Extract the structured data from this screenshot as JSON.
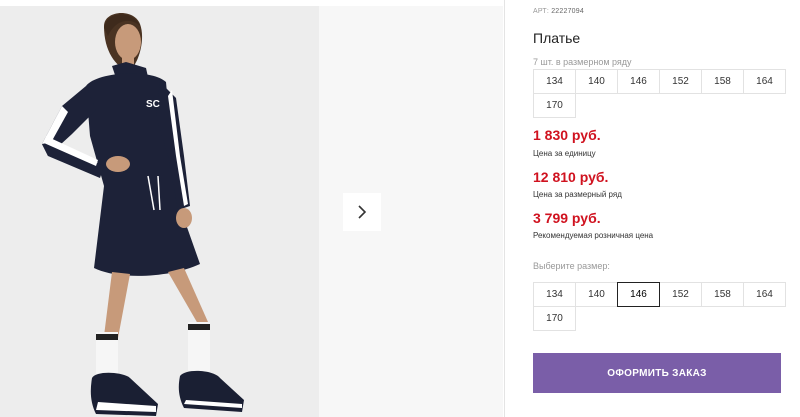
{
  "product": {
    "article_label": "АРТ:",
    "article_number": "22227094",
    "title": "Платье",
    "row_note": "7 шт. в размерном ряду",
    "row_sizes": [
      "134",
      "140",
      "146",
      "152",
      "158",
      "164",
      "170"
    ]
  },
  "prices": {
    "unit_price": "1 830 руб.",
    "unit_label": "Цена за единицу",
    "row_price": "12 810 руб.",
    "row_label": "Цена за размерный ряд",
    "retail_price": "3 799 руб.",
    "retail_label": "Рекомендуемая розничная цена",
    "accent_color": "#d0121f"
  },
  "size_picker": {
    "label": "Выберите размер:",
    "options": [
      "134",
      "140",
      "146",
      "152",
      "158",
      "164",
      "170"
    ],
    "selected": "146"
  },
  "order_button": {
    "label": "ОФОРМИТЬ ЗАКАЗ",
    "color": "#7a5ea8"
  },
  "gallery": {
    "next_icon": "chevron-right-icon"
  }
}
